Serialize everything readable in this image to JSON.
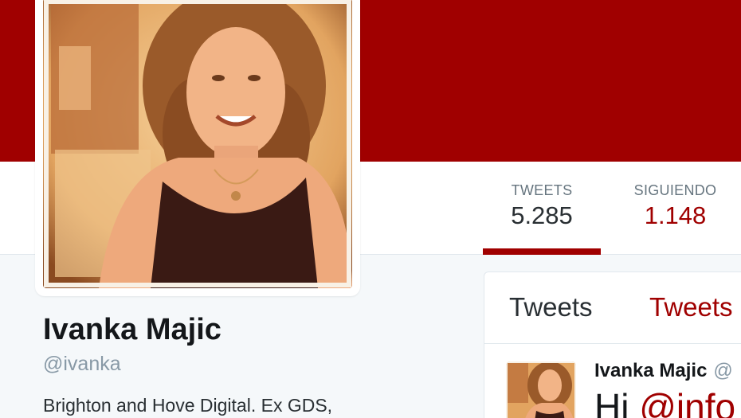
{
  "profile": {
    "name": "Ivanka Majic",
    "handle": "@ivanka",
    "bio": "Brighton and Hove Digital. Ex GDS,"
  },
  "stats": [
    {
      "label": "TWEETS",
      "value": "5.285",
      "active": true
    },
    {
      "label": "SIGUIENDO",
      "value": "1.148",
      "active": false
    }
  ],
  "timeline": {
    "tabs": [
      "Tweets",
      "Tweets"
    ],
    "tweet": {
      "author": "Ivanka Majic",
      "handle_fragment": "@",
      "text_prefix": "Hi ",
      "mention": "@info"
    }
  },
  "colors": {
    "brand": "#a00000",
    "background": "#f5f8fa",
    "text": "#292f33",
    "muted": "#8899a6"
  },
  "icons": {
    "profile_photo": "avatar-photo",
    "tweet_avatar": "avatar-thumbnail"
  }
}
